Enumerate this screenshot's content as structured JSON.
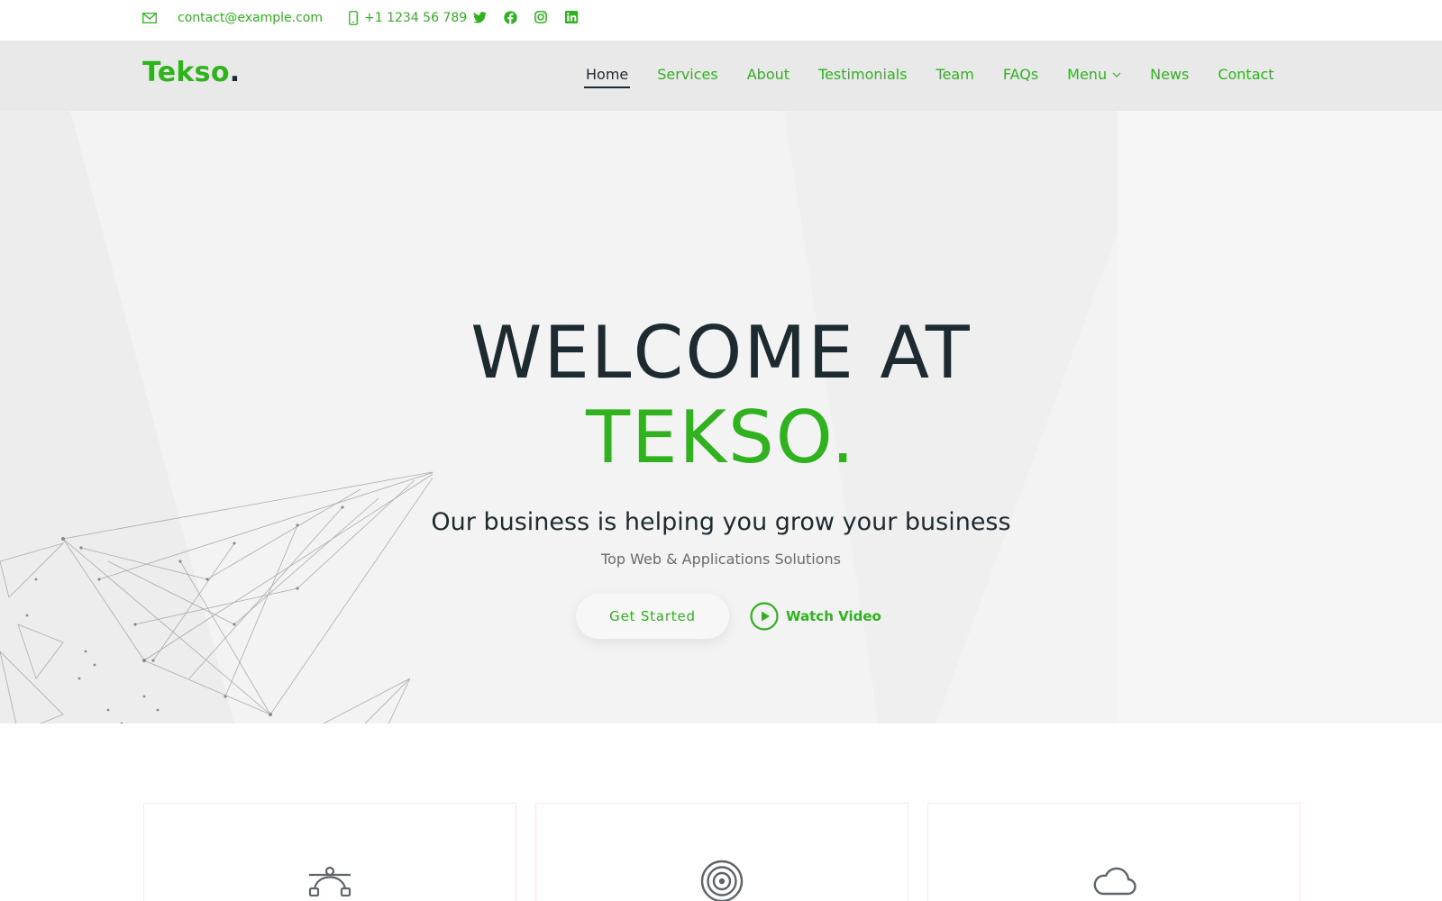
{
  "topbar": {
    "email": "contact@example.com",
    "phone": "+1 1234 56 789",
    "social": [
      {
        "name": "twitter-icon"
      },
      {
        "name": "facebook-icon"
      },
      {
        "name": "instagram-icon"
      },
      {
        "name": "linkedin-icon"
      }
    ]
  },
  "brand": {
    "name": "Tekso",
    "dot": ".",
    "accent_color": "#2fb21e",
    "dark_color": "#1d2b30"
  },
  "nav": {
    "items": [
      {
        "label": "Home",
        "active": true
      },
      {
        "label": "Services"
      },
      {
        "label": "About"
      },
      {
        "label": "Testimonials"
      },
      {
        "label": "Team"
      },
      {
        "label": "FAQs"
      },
      {
        "label": "Menu",
        "has_dropdown": true
      },
      {
        "label": "News"
      },
      {
        "label": "Contact"
      }
    ]
  },
  "hero": {
    "title_line1": "WELCOME AT",
    "title_line2": "TEKSO.",
    "subtitle": "Our business is helping you grow your business",
    "tagline": "Top Web & Applications Solutions",
    "cta_primary": "Get Started",
    "cta_video": "Watch Video"
  },
  "features": {
    "cards": [
      {
        "icon": "vector-path-icon"
      },
      {
        "icon": "target-icon"
      },
      {
        "icon": "cloud-icon"
      }
    ]
  }
}
